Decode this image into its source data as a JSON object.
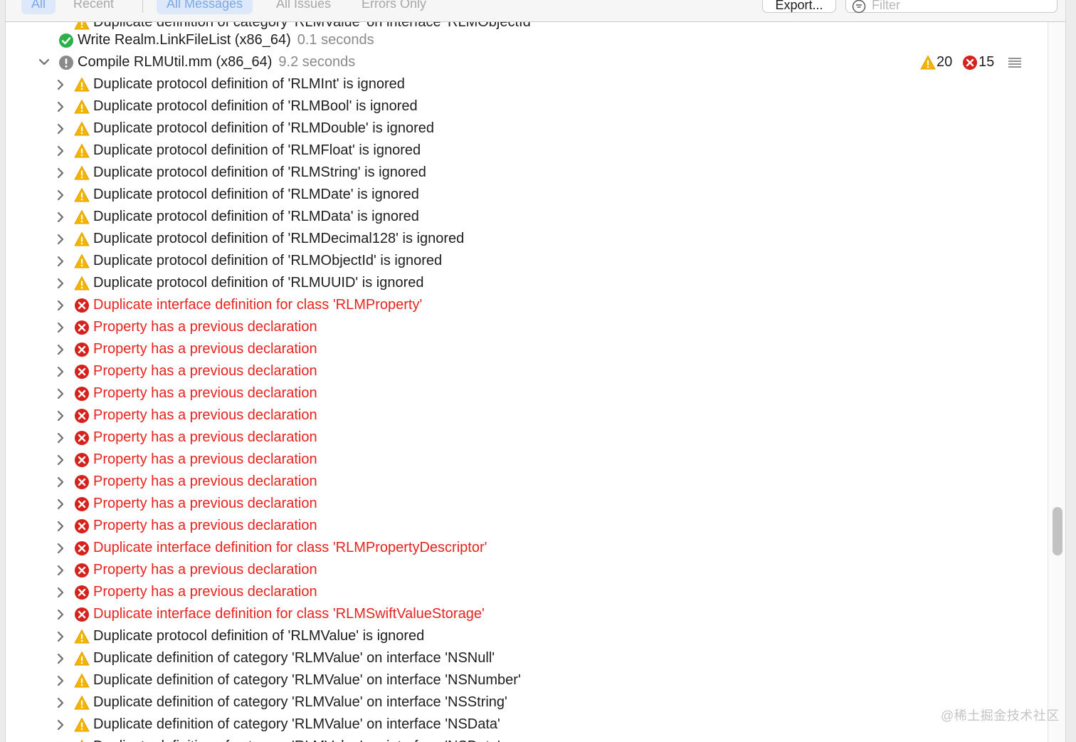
{
  "toolbar": {
    "segments": [
      "All",
      "Recent",
      "All Messages",
      "All Issues",
      "Errors Only"
    ],
    "export_label": "Export...",
    "filter_placeholder": "Filter"
  },
  "colors": {
    "error_text": "#e8231d",
    "warning_icon": "#f5b400",
    "error_icon": "#d6221c",
    "success_icon": "#2cb14a",
    "accent_selected": "#dde9fb"
  },
  "log": {
    "top_partial": "Duplicate definition of category 'RLMValue' on interface 'RLMObjectId'",
    "write_step": {
      "title": "Write Realm.LinkFileList (x86_64)",
      "duration": "0.1 seconds"
    },
    "compile_step": {
      "title": "Compile RLMUtil.mm (x86_64)",
      "duration": "9.2 seconds",
      "warning_count": "20",
      "error_count": "15"
    },
    "messages": [
      {
        "type": "warning",
        "text": "Duplicate protocol definition of 'RLMInt' is ignored"
      },
      {
        "type": "warning",
        "text": "Duplicate protocol definition of 'RLMBool' is ignored"
      },
      {
        "type": "warning",
        "text": "Duplicate protocol definition of 'RLMDouble' is ignored"
      },
      {
        "type": "warning",
        "text": "Duplicate protocol definition of 'RLMFloat' is ignored"
      },
      {
        "type": "warning",
        "text": "Duplicate protocol definition of 'RLMString' is ignored"
      },
      {
        "type": "warning",
        "text": "Duplicate protocol definition of 'RLMDate' is ignored"
      },
      {
        "type": "warning",
        "text": "Duplicate protocol definition of 'RLMData' is ignored"
      },
      {
        "type": "warning",
        "text": "Duplicate protocol definition of 'RLMDecimal128' is ignored"
      },
      {
        "type": "warning",
        "text": "Duplicate protocol definition of 'RLMObjectId' is ignored"
      },
      {
        "type": "warning",
        "text": "Duplicate protocol definition of 'RLMUUID' is ignored"
      },
      {
        "type": "error",
        "text": "Duplicate interface definition for class 'RLMProperty'"
      },
      {
        "type": "error",
        "text": "Property has a previous declaration"
      },
      {
        "type": "error",
        "text": "Property has a previous declaration"
      },
      {
        "type": "error",
        "text": "Property has a previous declaration"
      },
      {
        "type": "error",
        "text": "Property has a previous declaration"
      },
      {
        "type": "error",
        "text": "Property has a previous declaration"
      },
      {
        "type": "error",
        "text": "Property has a previous declaration"
      },
      {
        "type": "error",
        "text": "Property has a previous declaration"
      },
      {
        "type": "error",
        "text": "Property has a previous declaration"
      },
      {
        "type": "error",
        "text": "Property has a previous declaration"
      },
      {
        "type": "error",
        "text": "Property has a previous declaration"
      },
      {
        "type": "error",
        "text": "Duplicate interface definition for class 'RLMPropertyDescriptor'"
      },
      {
        "type": "error",
        "text": "Property has a previous declaration"
      },
      {
        "type": "error",
        "text": "Property has a previous declaration"
      },
      {
        "type": "error",
        "text": "Duplicate interface definition for class 'RLMSwiftValueStorage'"
      },
      {
        "type": "warning",
        "text": "Duplicate protocol definition of 'RLMValue' is ignored"
      },
      {
        "type": "warning",
        "text": "Duplicate definition of category 'RLMValue' on interface 'NSNull'"
      },
      {
        "type": "warning",
        "text": "Duplicate definition of category 'RLMValue' on interface 'NSNumber'"
      },
      {
        "type": "warning",
        "text": "Duplicate definition of category 'RLMValue' on interface 'NSString'"
      },
      {
        "type": "warning",
        "text": "Duplicate definition of category 'RLMValue' on interface 'NSData'"
      },
      {
        "type": "warning",
        "text": "Duplicate definition of category 'RLMValue' on interface 'NSDate'"
      }
    ]
  },
  "watermark": "@稀土掘金技术社区"
}
